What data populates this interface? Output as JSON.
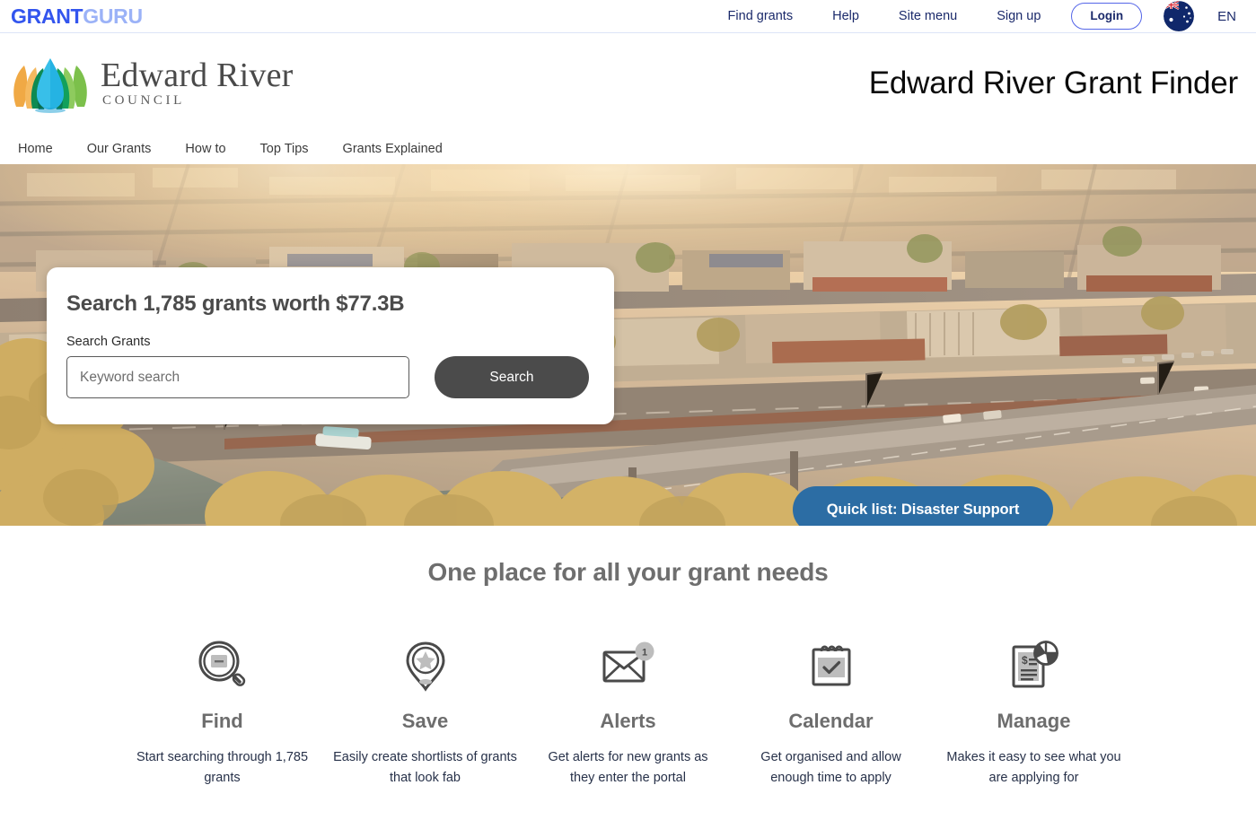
{
  "topbar": {
    "brand": {
      "part1": "GRANT",
      "part2": "GURU"
    },
    "nav": [
      {
        "label": "Find grants",
        "name": "find-grants"
      },
      {
        "label": "Help",
        "name": "help"
      },
      {
        "label": "Site menu",
        "name": "site-menu"
      },
      {
        "label": "Sign up",
        "name": "sign-up"
      }
    ],
    "login_label": "Login",
    "flag": "australia-flag-icon",
    "language": "EN"
  },
  "council": {
    "name": "Edward River",
    "subtitle": "COUNCIL",
    "logo_icon": "edward-river-council-leaf-logo"
  },
  "header": {
    "page_title": "Edward River Grant Finder"
  },
  "subnav": [
    {
      "label": "Home",
      "name": "home"
    },
    {
      "label": "Our Grants",
      "name": "our-grants"
    },
    {
      "label": "How to",
      "name": "how-to"
    },
    {
      "label": "Top Tips",
      "name": "top-tips"
    },
    {
      "label": "Grants Explained",
      "name": "grants-explained"
    }
  ],
  "hero": {
    "search_card": {
      "heading": "Search 1,785 grants worth $77.3B",
      "field_label": "Search Grants",
      "input_value": "",
      "input_placeholder": "Keyword search",
      "button_label": "Search"
    },
    "quick_list_label": "Quick list: Disaster Support",
    "quick_list_color": "#2c6da4"
  },
  "features": {
    "heading": "One place for all your grant needs",
    "items": [
      {
        "icon": "magnifier-document-icon",
        "title": "Find",
        "desc": "Start searching through 1,785 grants"
      },
      {
        "icon": "map-pin-star-icon",
        "title": "Save",
        "desc": "Easily create shortlists of grants that look fab"
      },
      {
        "icon": "envelope-badge-icon",
        "title": "Alerts",
        "badge": "1",
        "desc": "Get alerts for new grants as they enter the portal"
      },
      {
        "icon": "calendar-check-icon",
        "title": "Calendar",
        "desc": "Get organised and allow enough time to apply"
      },
      {
        "icon": "document-pie-chart-icon",
        "title": "Manage",
        "desc": "Makes it easy to see what you are applying for"
      }
    ]
  }
}
